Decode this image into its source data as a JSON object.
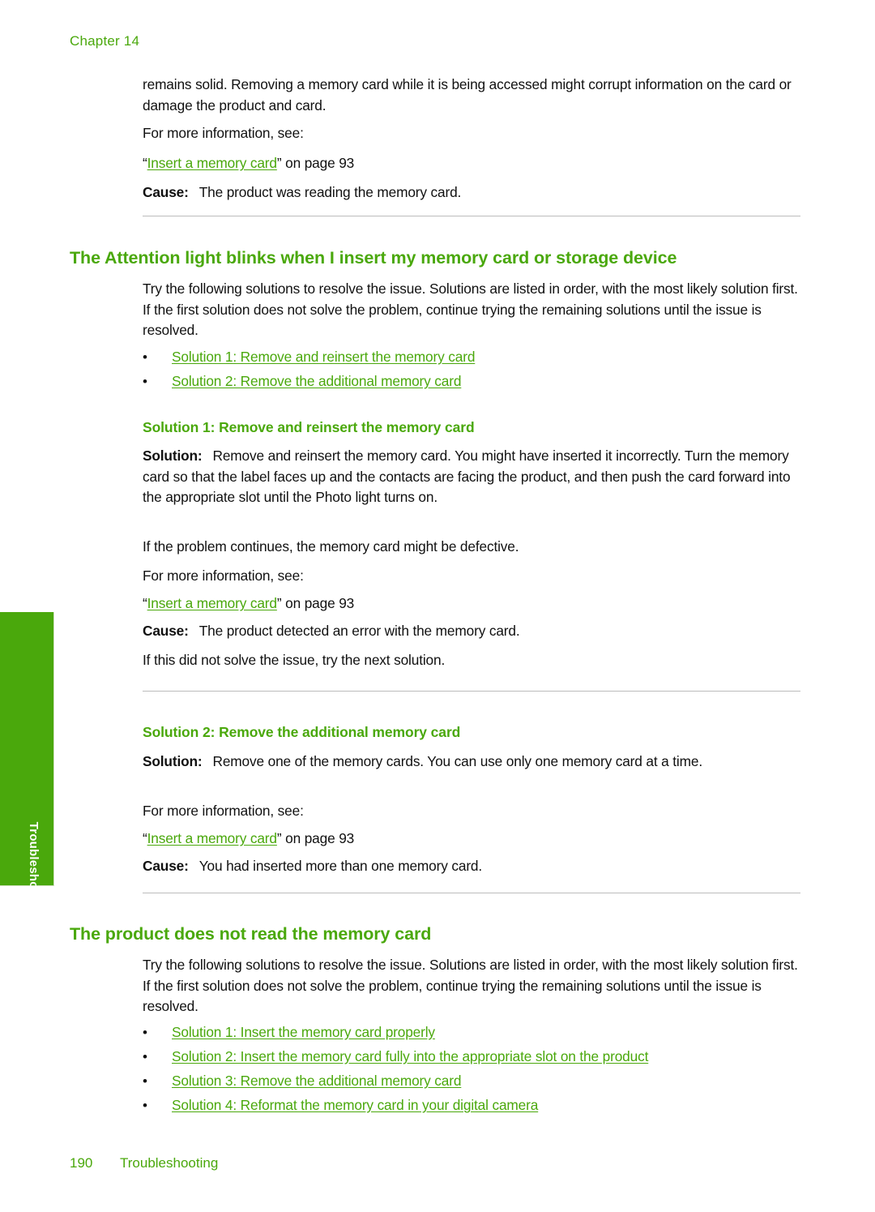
{
  "page": {
    "chapter_header": "Chapter 14",
    "side_tab_label": "Troubleshooting",
    "footer_page_number": "190",
    "footer_section": "Troubleshooting",
    "accent_green": "#4aa80c",
    "rule_color": "#bcbcbc",
    "body_color": "#111111"
  },
  "intro": {
    "paragraph": "remains solid. Removing a memory card while it is being accessed might corrupt information on the card or damage the product and card.",
    "for_more_information": "For more information, see:",
    "xref_open_quote": "“",
    "xref_link": "Insert a memory card",
    "xref_close": "” on page 93",
    "cause_label": "Cause:",
    "cause_text": "The product was reading the memory card."
  },
  "section1": {
    "heading": "The Attention light blinks when I insert my memory card or storage device",
    "intro": "Try the following solutions to resolve the issue. Solutions are listed in order, with the most likely solution first. If the first solution does not solve the problem, continue trying the remaining solutions until the issue is resolved.",
    "links": [
      "Solution 1: Remove and reinsert the memory card",
      "Solution 2: Remove the additional memory card"
    ],
    "solution1": {
      "heading": "Solution 1: Remove and reinsert the memory card",
      "solution_label": "Solution:",
      "solution_text": "Remove and reinsert the memory card. You might have inserted it incorrectly. Turn the memory card so that the label faces up and the contacts are facing the product, and then push the card forward into the appropriate slot until the Photo light turns on.",
      "note": "If the problem continues, the memory card might be defective.",
      "for_more_information": "For more information, see:",
      "xref_open_quote": "“",
      "xref_link": "Insert a memory card",
      "xref_close": "” on page 93",
      "cause_label": "Cause:",
      "cause_text": "The product detected an error with the memory card.",
      "next": "If this did not solve the issue, try the next solution."
    },
    "solution2": {
      "heading": "Solution 2: Remove the additional memory card",
      "solution_label": "Solution:",
      "solution_text": "Remove one of the memory cards. You can use only one memory card at a time.",
      "for_more_information": "For more information, see:",
      "xref_open_quote": "“",
      "xref_link": "Insert a memory card",
      "xref_close": "” on page 93",
      "cause_label": "Cause:",
      "cause_text": "You had inserted more than one memory card."
    }
  },
  "section2": {
    "heading": "The product does not read the memory card",
    "intro": "Try the following solutions to resolve the issue. Solutions are listed in order, with the most likely solution first. If the first solution does not solve the problem, continue trying the remaining solutions until the issue is resolved.",
    "links": [
      "Solution 1: Insert the memory card properly",
      "Solution 2: Insert the memory card fully into the appropriate slot on the product",
      "Solution 3: Remove the additional memory card",
      "Solution 4: Reformat the memory card in your digital camera"
    ]
  },
  "bullet_glyph": "•"
}
